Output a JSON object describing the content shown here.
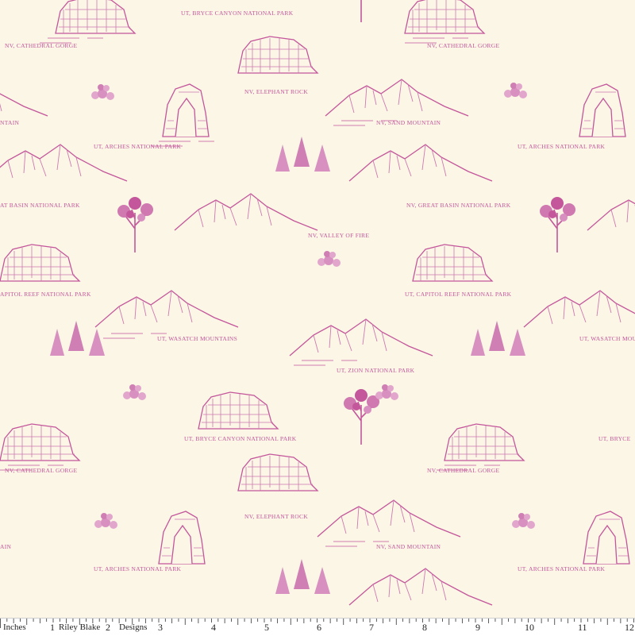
{
  "pattern": {
    "ink": "#c4569b",
    "ink_light": "#d78abd",
    "background": "#fbf6e6",
    "labels": [
      "UT, BRYCE CANYON NATIONAL PARK",
      "NV, CATHEDRAL GORGE",
      "NV, CATHEDRAL GORGE",
      "NV, ELEPHANT ROCK",
      "NTAIN",
      "NV, SAND MOUNTAIN",
      "UT, ARCHES NATIONAL PARK",
      "UT, ARCHES NATIONAL PARK",
      "AT BASIN NATIONAL PARK",
      "NV, GREAT BASIN NATIONAL PARK",
      "NV, VALLEY OF FIRE",
      "APITOL REEF NATIONAL PARK",
      "UT, CAPITOL REEF NATIONAL PARK",
      "UT, WASATCH MOUNTAINS",
      "UT, WASATCH MOUNTAINS",
      "UT, ZION NATIONAL PARK",
      "UT, BRYCE CANYON NATIONAL PARK",
      "UT, BRYCE",
      "NV, CATHEDRAL GORGE",
      "NV, CATHEDRAL GORGE",
      "NV, ELEPHANT ROCK",
      "NV, SAND MOUNTAIN",
      "AIN",
      "UT, ARCHES NATIONAL PARK",
      "UT, ARCHES NATIONAL PARK"
    ]
  },
  "ruler": {
    "unit_label": "Inches",
    "brand_1": "Riley Blake",
    "brand_2": "Designs",
    "numbers": [
      "1",
      "2",
      "3",
      "4",
      "5",
      "6",
      "7",
      "8",
      "9",
      "10",
      "11",
      "12"
    ]
  }
}
